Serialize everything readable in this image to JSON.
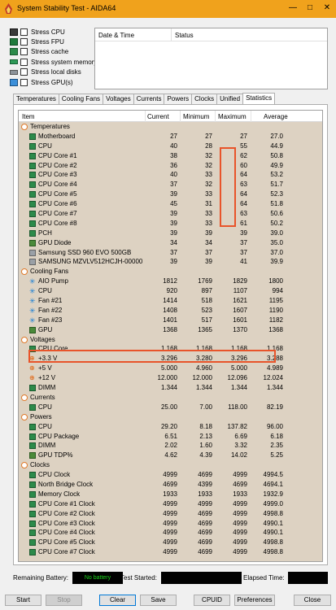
{
  "window": {
    "title": "System Stability Test - AIDA64"
  },
  "stress": [
    {
      "label": "Stress CPU",
      "icon": "cpu-chip-icon",
      "checked": false
    },
    {
      "label": "Stress FPU",
      "icon": "fpu-icon",
      "checked": false
    },
    {
      "label": "Stress cache",
      "icon": "cache-chip-icon",
      "checked": false
    },
    {
      "label": "Stress system memory",
      "icon": "memory-module-icon",
      "checked": false
    },
    {
      "label": "Stress local disks",
      "icon": "disk-drive-icon",
      "checked": false
    },
    {
      "label": "Stress GPU(s)",
      "icon": "gpu-monitor-icon",
      "checked": false
    }
  ],
  "status_log": {
    "col_datetime": "Date & Time",
    "col_status": "Status"
  },
  "tabs": [
    "Temperatures",
    "Cooling Fans",
    "Voltages",
    "Currents",
    "Powers",
    "Clocks",
    "Unified",
    "Statistics"
  ],
  "active_tab": "Statistics",
  "table": {
    "headers": {
      "item": "Item",
      "current": "Current",
      "minimum": "Minimum",
      "maximum": "Maximum",
      "average": "Average"
    },
    "rows": [
      {
        "kind": "cat",
        "label": "Temperatures"
      },
      {
        "kind": "item",
        "icon": "sq",
        "label": "Motherboard",
        "cur": "27",
        "min": "27",
        "max": "27",
        "avg": "27.0"
      },
      {
        "kind": "item",
        "icon": "sq",
        "label": "CPU",
        "cur": "40",
        "min": "28",
        "max": "55",
        "avg": "44.9"
      },
      {
        "kind": "item",
        "icon": "sq",
        "label": "CPU Core #1",
        "cur": "38",
        "min": "32",
        "max": "62",
        "avg": "50.8"
      },
      {
        "kind": "item",
        "icon": "sq",
        "label": "CPU Core #2",
        "cur": "36",
        "min": "32",
        "max": "60",
        "avg": "49.9"
      },
      {
        "kind": "item",
        "icon": "sq",
        "label": "CPU Core #3",
        "cur": "40",
        "min": "33",
        "max": "64",
        "avg": "53.2"
      },
      {
        "kind": "item",
        "icon": "sq",
        "label": "CPU Core #4",
        "cur": "37",
        "min": "32",
        "max": "63",
        "avg": "51.7"
      },
      {
        "kind": "item",
        "icon": "sq",
        "label": "CPU Core #5",
        "cur": "39",
        "min": "33",
        "max": "64",
        "avg": "52.3"
      },
      {
        "kind": "item",
        "icon": "sq",
        "label": "CPU Core #6",
        "cur": "45",
        "min": "31",
        "max": "64",
        "avg": "51.8"
      },
      {
        "kind": "item",
        "icon": "sq",
        "label": "CPU Core #7",
        "cur": "39",
        "min": "33",
        "max": "63",
        "avg": "50.6"
      },
      {
        "kind": "item",
        "icon": "sq",
        "label": "CPU Core #8",
        "cur": "39",
        "min": "33",
        "max": "61",
        "avg": "50.2"
      },
      {
        "kind": "item",
        "icon": "sq",
        "label": "PCH",
        "cur": "39",
        "min": "39",
        "max": "39",
        "avg": "39.0"
      },
      {
        "kind": "item",
        "icon": "gpu",
        "label": "GPU Diode",
        "cur": "34",
        "min": "34",
        "max": "37",
        "avg": "35.0"
      },
      {
        "kind": "item",
        "icon": "disk",
        "label": "Samsung SSD 960 EVO 500GB",
        "cur": "37",
        "min": "37",
        "max": "37",
        "avg": "37.0"
      },
      {
        "kind": "item",
        "icon": "disk",
        "label": "SAMSUNG MZVLV512HCJH-00000",
        "cur": "39",
        "min": "39",
        "max": "41",
        "avg": "39.9"
      },
      {
        "kind": "cat",
        "label": "Cooling Fans"
      },
      {
        "kind": "item",
        "icon": "fan",
        "label": "AIO Pump",
        "cur": "1812",
        "min": "1769",
        "max": "1829",
        "avg": "1800"
      },
      {
        "kind": "item",
        "icon": "fan",
        "label": "CPU",
        "cur": "920",
        "min": "897",
        "max": "1107",
        "avg": "994"
      },
      {
        "kind": "item",
        "icon": "fan",
        "label": "Fan #21",
        "cur": "1414",
        "min": "518",
        "max": "1621",
        "avg": "1195"
      },
      {
        "kind": "item",
        "icon": "fan",
        "label": "Fan #22",
        "cur": "1408",
        "min": "523",
        "max": "1607",
        "avg": "1190"
      },
      {
        "kind": "item",
        "icon": "fan",
        "label": "Fan #23",
        "cur": "1401",
        "min": "517",
        "max": "1601",
        "avg": "1182"
      },
      {
        "kind": "item",
        "icon": "gpu",
        "label": "GPU",
        "cur": "1368",
        "min": "1365",
        "max": "1370",
        "avg": "1368"
      },
      {
        "kind": "cat",
        "label": "Voltages"
      },
      {
        "kind": "item",
        "icon": "sq",
        "label": "CPU Core",
        "cur": "1.168",
        "min": "1.168",
        "max": "1.168",
        "avg": "1.168"
      },
      {
        "kind": "item",
        "icon": "volt",
        "label": "+3.3 V",
        "cur": "3.296",
        "min": "3.280",
        "max": "3.296",
        "avg": "3.288"
      },
      {
        "kind": "item",
        "icon": "volt",
        "label": "+5 V",
        "cur": "5.000",
        "min": "4.960",
        "max": "5.000",
        "avg": "4.989"
      },
      {
        "kind": "item",
        "icon": "volt",
        "label": "+12 V",
        "cur": "12.000",
        "min": "12.000",
        "max": "12.096",
        "avg": "12.024"
      },
      {
        "kind": "item",
        "icon": "sq",
        "label": "DIMM",
        "cur": "1.344",
        "min": "1.344",
        "max": "1.344",
        "avg": "1.344"
      },
      {
        "kind": "cat",
        "label": "Currents"
      },
      {
        "kind": "item",
        "icon": "sq",
        "label": "CPU",
        "cur": "25.00",
        "min": "7.00",
        "max": "118.00",
        "avg": "82.19"
      },
      {
        "kind": "cat",
        "label": "Powers"
      },
      {
        "kind": "item",
        "icon": "sq",
        "label": "CPU",
        "cur": "29.20",
        "min": "8.18",
        "max": "137.82",
        "avg": "96.00"
      },
      {
        "kind": "item",
        "icon": "sq",
        "label": "CPU Package",
        "cur": "6.51",
        "min": "2.13",
        "max": "6.69",
        "avg": "6.18"
      },
      {
        "kind": "item",
        "icon": "sq",
        "label": "DIMM",
        "cur": "2.02",
        "min": "1.60",
        "max": "3.32",
        "avg": "2.35"
      },
      {
        "kind": "item",
        "icon": "gpu",
        "label": "GPU TDP%",
        "cur": "4.62",
        "min": "4.39",
        "max": "14.02",
        "avg": "5.25"
      },
      {
        "kind": "cat",
        "label": "Clocks"
      },
      {
        "kind": "item",
        "icon": "sq",
        "label": "CPU Clock",
        "cur": "4999",
        "min": "4699",
        "max": "4999",
        "avg": "4994.5"
      },
      {
        "kind": "item",
        "icon": "sq",
        "label": "North Bridge Clock",
        "cur": "4699",
        "min": "4399",
        "max": "4699",
        "avg": "4694.1"
      },
      {
        "kind": "item",
        "icon": "sq",
        "label": "Memory Clock",
        "cur": "1933",
        "min": "1933",
        "max": "1933",
        "avg": "1932.9"
      },
      {
        "kind": "item",
        "icon": "sq",
        "label": "CPU Core #1 Clock",
        "cur": "4999",
        "min": "4999",
        "max": "4999",
        "avg": "4999.0"
      },
      {
        "kind": "item",
        "icon": "sq",
        "label": "CPU Core #2 Clock",
        "cur": "4999",
        "min": "4699",
        "max": "4999",
        "avg": "4998.8"
      },
      {
        "kind": "item",
        "icon": "sq",
        "label": "CPU Core #3 Clock",
        "cur": "4999",
        "min": "4699",
        "max": "4999",
        "avg": "4990.1"
      },
      {
        "kind": "item",
        "icon": "sq",
        "label": "CPU Core #4 Clock",
        "cur": "4999",
        "min": "4699",
        "max": "4999",
        "avg": "4990.1"
      },
      {
        "kind": "item",
        "icon": "sq",
        "label": "CPU Core #5 Clock",
        "cur": "4999",
        "min": "4699",
        "max": "4999",
        "avg": "4998.8"
      },
      {
        "kind": "item",
        "icon": "sq",
        "label": "CPU Core #7 Clock",
        "cur": "4999",
        "min": "4699",
        "max": "4999",
        "avg": "4998.8"
      }
    ]
  },
  "footer": {
    "remaining_battery_label": "Remaining Battery:",
    "battery_value": "No battery",
    "test_started_label": "Test Started:",
    "elapsed_time_label": "Elapsed Time:"
  },
  "buttons": {
    "start": "Start",
    "stop": "Stop",
    "clear": "Clear",
    "save": "Save",
    "cpuid": "CPUID",
    "preferences": "Preferences",
    "close": "Close"
  },
  "colors": {
    "titlebar": "#f0a21c",
    "table_bg": "#ddd2c2",
    "highlight": "#e8542a",
    "battery_text": "#19d419"
  }
}
